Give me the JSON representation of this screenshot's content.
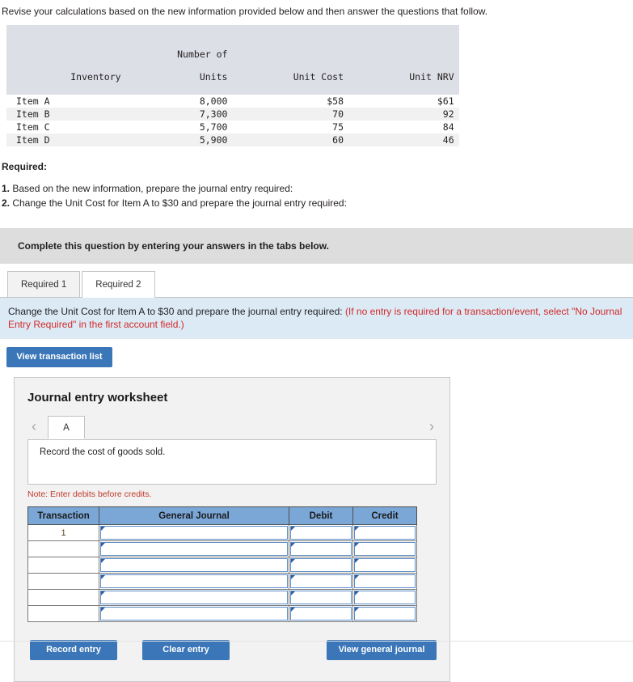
{
  "intro": "Revise your calculations based on the new information provided below and then answer the questions that follow.",
  "inventory_table": {
    "headers": {
      "inventory": "Inventory",
      "units_line1": "Number of",
      "units_line2": "Units",
      "unit_cost": "Unit Cost",
      "unit_nrv": "Unit NRV"
    },
    "rows": [
      {
        "inventory": "Item A",
        "units": "8,000",
        "unit_cost": "$58",
        "unit_nrv": "$61"
      },
      {
        "inventory": "Item B",
        "units": "7,300",
        "unit_cost": "70",
        "unit_nrv": "92"
      },
      {
        "inventory": "Item C",
        "units": "5,700",
        "unit_cost": "75",
        "unit_nrv": "84"
      },
      {
        "inventory": "Item D",
        "units": "5,900",
        "unit_cost": "60",
        "unit_nrv": "46"
      }
    ]
  },
  "required": {
    "heading": "Required:",
    "items": [
      {
        "num": "1.",
        "text": "Based on the new information, prepare the journal entry required:"
      },
      {
        "num": "2.",
        "text": "Change the Unit Cost for Item A to $30 and prepare the journal entry required:"
      }
    ]
  },
  "banner": "Complete this question by entering your answers in the tabs below.",
  "tabs": [
    {
      "label": "Required 1",
      "active": false
    },
    {
      "label": "Required 2",
      "active": true
    }
  ],
  "instruction": {
    "black": "Change the Unit Cost for Item A to $30 and prepare the journal entry required:",
    "red": "(If no entry is required for a transaction/event, select \"No Journal Entry Required\" in the first account field.)"
  },
  "view_transaction_list_label": "View transaction list",
  "worksheet": {
    "title": "Journal entry worksheet",
    "prev_icon": "chevron-left-icon",
    "next_icon": "chevron-right-icon",
    "tab_label": "A",
    "description": "Record the cost of goods sold.",
    "note": "Note: Enter debits before credits.",
    "journal": {
      "columns": [
        "Transaction",
        "General Journal",
        "Debit",
        "Credit"
      ],
      "rows": [
        {
          "transaction": "1",
          "general_journal": "",
          "debit": "",
          "credit": ""
        },
        {
          "transaction": "",
          "general_journal": "",
          "debit": "",
          "credit": ""
        },
        {
          "transaction": "",
          "general_journal": "",
          "debit": "",
          "credit": ""
        },
        {
          "transaction": "",
          "general_journal": "",
          "debit": "",
          "credit": ""
        },
        {
          "transaction": "",
          "general_journal": "",
          "debit": "",
          "credit": ""
        },
        {
          "transaction": "",
          "general_journal": "",
          "debit": "",
          "credit": ""
        }
      ]
    },
    "buttons": {
      "record": "Record entry",
      "clear": "Clear entry",
      "view_general_journal": "View general journal"
    }
  },
  "colors": {
    "accent_blue": "#3a76b8",
    "table_header_blue": "#7ba7d7",
    "instruction_bg": "#dbeaf5",
    "banner_gray": "#dddddd",
    "red_text": "#d32a2a"
  }
}
